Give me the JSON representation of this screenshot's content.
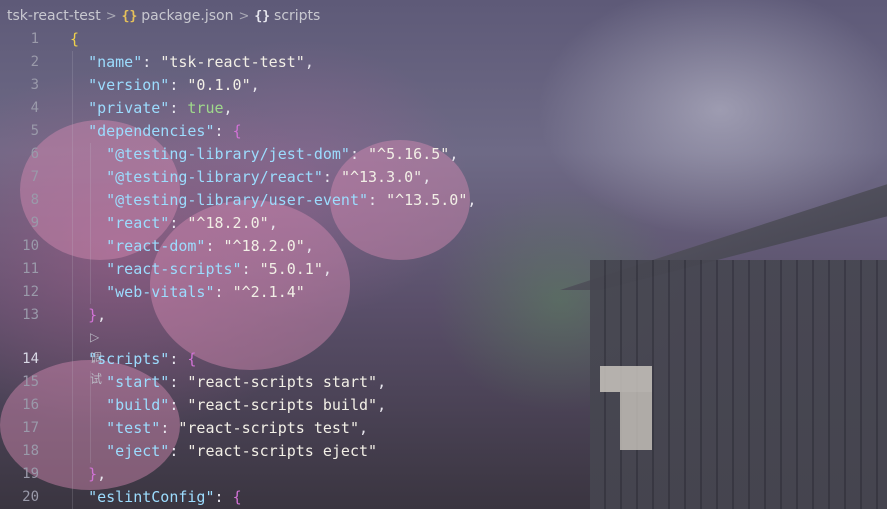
{
  "breadcrumb": {
    "folder": "tsk-react-test",
    "file": "package.json",
    "symbol": "scripts",
    "separator": ">"
  },
  "icons": {
    "json_file": "braces-icon-yellow",
    "symbol": "braces-icon-white",
    "run_debug": "play-icon"
  },
  "codelens": {
    "label": "调试"
  },
  "lines": [
    {
      "n": "1",
      "tokens": [
        {
          "t": "{",
          "c": "b1"
        }
      ]
    },
    {
      "n": "2",
      "tokens": [
        {
          "t": "  "
        },
        {
          "t": "\"name\"",
          "c": "k"
        },
        {
          "t": ": "
        },
        {
          "t": "\"tsk-react-test\"",
          "c": "s"
        },
        {
          "t": ","
        }
      ]
    },
    {
      "n": "3",
      "tokens": [
        {
          "t": "  "
        },
        {
          "t": "\"version\"",
          "c": "k"
        },
        {
          "t": ": "
        },
        {
          "t": "\"0.1.0\"",
          "c": "s"
        },
        {
          "t": ","
        }
      ]
    },
    {
      "n": "4",
      "tokens": [
        {
          "t": "  "
        },
        {
          "t": "\"private\"",
          "c": "k"
        },
        {
          "t": ": "
        },
        {
          "t": "true",
          "c": "bool"
        },
        {
          "t": ","
        }
      ]
    },
    {
      "n": "5",
      "tokens": [
        {
          "t": "  "
        },
        {
          "t": "\"dependencies\"",
          "c": "k"
        },
        {
          "t": ": "
        },
        {
          "t": "{",
          "c": "b2"
        }
      ]
    },
    {
      "n": "6",
      "tokens": [
        {
          "t": "    "
        },
        {
          "t": "\"@testing-library/jest-dom\"",
          "c": "k"
        },
        {
          "t": ": "
        },
        {
          "t": "\"^5.16.5\"",
          "c": "s"
        },
        {
          "t": ","
        }
      ]
    },
    {
      "n": "7",
      "tokens": [
        {
          "t": "    "
        },
        {
          "t": "\"@testing-library/react\"",
          "c": "k"
        },
        {
          "t": ": "
        },
        {
          "t": "\"^13.3.0\"",
          "c": "s"
        },
        {
          "t": ","
        }
      ]
    },
    {
      "n": "8",
      "tokens": [
        {
          "t": "    "
        },
        {
          "t": "\"@testing-library/user-event\"",
          "c": "k"
        },
        {
          "t": ": "
        },
        {
          "t": "\"^13.5.0\"",
          "c": "s"
        },
        {
          "t": ","
        }
      ]
    },
    {
      "n": "9",
      "tokens": [
        {
          "t": "    "
        },
        {
          "t": "\"react\"",
          "c": "k"
        },
        {
          "t": ": "
        },
        {
          "t": "\"^18.2.0\"",
          "c": "s"
        },
        {
          "t": ","
        }
      ]
    },
    {
      "n": "10",
      "tokens": [
        {
          "t": "    "
        },
        {
          "t": "\"react-dom\"",
          "c": "k"
        },
        {
          "t": ": "
        },
        {
          "t": "\"^18.2.0\"",
          "c": "s"
        },
        {
          "t": ","
        }
      ]
    },
    {
      "n": "11",
      "tokens": [
        {
          "t": "    "
        },
        {
          "t": "\"react-scripts\"",
          "c": "k"
        },
        {
          "t": ": "
        },
        {
          "t": "\"5.0.1\"",
          "c": "s"
        },
        {
          "t": ","
        }
      ]
    },
    {
      "n": "12",
      "tokens": [
        {
          "t": "    "
        },
        {
          "t": "\"web-vitals\"",
          "c": "k"
        },
        {
          "t": ": "
        },
        {
          "t": "\"^2.1.4\"",
          "c": "s"
        }
      ]
    },
    {
      "n": "13",
      "tokens": [
        {
          "t": "  "
        },
        {
          "t": "}",
          "c": "b2"
        },
        {
          "t": ","
        }
      ]
    },
    {
      "n": "14",
      "active": true,
      "tokens": [
        {
          "t": "  "
        },
        {
          "t": "\"scripts\"",
          "c": "k"
        },
        {
          "t": ": "
        },
        {
          "t": "{",
          "c": "b2"
        }
      ]
    },
    {
      "n": "15",
      "tokens": [
        {
          "t": "    "
        },
        {
          "t": "\"start\"",
          "c": "k"
        },
        {
          "t": ": "
        },
        {
          "t": "\"react-scripts start\"",
          "c": "s"
        },
        {
          "t": ","
        }
      ]
    },
    {
      "n": "16",
      "tokens": [
        {
          "t": "    "
        },
        {
          "t": "\"build\"",
          "c": "k"
        },
        {
          "t": ": "
        },
        {
          "t": "\"react-scripts build\"",
          "c": "s"
        },
        {
          "t": ","
        }
      ]
    },
    {
      "n": "17",
      "tokens": [
        {
          "t": "    "
        },
        {
          "t": "\"test\"",
          "c": "k"
        },
        {
          "t": ": "
        },
        {
          "t": "\"react-scripts test\"",
          "c": "s"
        },
        {
          "t": ","
        }
      ]
    },
    {
      "n": "18",
      "tokens": [
        {
          "t": "    "
        },
        {
          "t": "\"eject\"",
          "c": "k"
        },
        {
          "t": ": "
        },
        {
          "t": "\"react-scripts eject\"",
          "c": "s"
        }
      ]
    },
    {
      "n": "19",
      "tokens": [
        {
          "t": "  "
        },
        {
          "t": "}",
          "c": "b2"
        },
        {
          "t": ","
        }
      ]
    },
    {
      "n": "20",
      "tokens": [
        {
          "t": "  "
        },
        {
          "t": "\"eslintConfig\"",
          "c": "k"
        },
        {
          "t": ": "
        },
        {
          "t": "{",
          "c": "b2"
        }
      ]
    }
  ]
}
